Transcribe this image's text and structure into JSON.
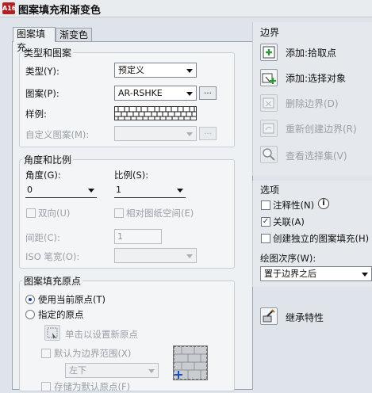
{
  "window": {
    "title": "图案填充和渐变色",
    "app_icon_text": "A16"
  },
  "tabs": [
    {
      "label": "图案填充"
    },
    {
      "label": "渐变色"
    }
  ],
  "type_pattern": {
    "group_title": "类型和图案",
    "type_label": "类型(Y):",
    "type_value": "预定义",
    "pattern_label": "图案(P):",
    "pattern_value": "AR-RSHKE",
    "pattern_button": "...",
    "swatch_label": "样例:",
    "custom_label": "自定义图案(M):",
    "custom_value": "",
    "custom_button": "..."
  },
  "angle_scale": {
    "group_title": "角度和比例",
    "angle_label": "角度(G):",
    "angle_value": "0",
    "scale_label": "比例(S):",
    "scale_value": "1",
    "double_label": "双向(U)",
    "relative_label": "相对图纸空间(E)",
    "spacing_label": "间距(C):",
    "spacing_value": "1",
    "iso_label": "ISO 笔宽(O):",
    "iso_value": ""
  },
  "origin": {
    "group_title": "图案填充原点",
    "use_current_label": "使用当前原点(T)",
    "specified_label": "指定的原点",
    "click_set_label": "单击以设置新原点",
    "default_boundary_label": "默认为边界范围(X)",
    "position_value": "左下",
    "store_default_label": "存储为默认原点(F)"
  },
  "boundary": {
    "section_title": "边界",
    "add_pick_label": "添加:拾取点",
    "add_select_label": "添加:选择对象",
    "remove_label": "删除边界(D)",
    "recreate_label": "重新创建边界(R)",
    "view_label": "查看选择集(V)"
  },
  "options": {
    "section_title": "选项",
    "annotative_label": "注释性(N)",
    "info_icon_text": "i",
    "associative_label": "关联(A)",
    "associative_checked": true,
    "separate_label": "创建独立的图案填充(H)",
    "draw_order_label": "绘图次序(W):",
    "draw_order_value": "置于边界之后"
  },
  "inherit": {
    "label": "继承特性"
  },
  "colors": {
    "accent_blue": "#1c3f8f",
    "plus_green": "#2e9b3a",
    "app_red": "#b32222"
  }
}
